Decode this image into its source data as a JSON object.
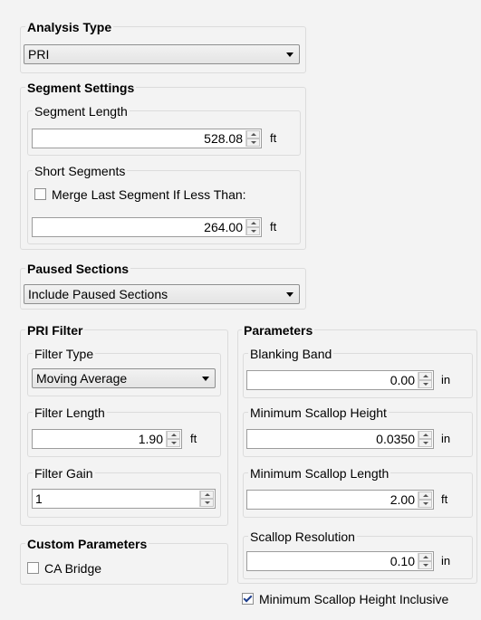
{
  "analysis_type": {
    "title": "Analysis Type",
    "selected": "PRI"
  },
  "segment_settings": {
    "title": "Segment Settings",
    "segment_length": {
      "label": "Segment Length",
      "value": "528.08",
      "unit": "ft"
    },
    "short_segments": {
      "label": "Short Segments",
      "merge_label": "Merge Last Segment If Less Than:",
      "merge_checked": false,
      "value": "264.00",
      "unit": "ft"
    }
  },
  "paused_sections": {
    "title": "Paused Sections",
    "selected": "Include Paused Sections"
  },
  "pri_filter": {
    "title": "PRI Filter",
    "filter_type": {
      "label": "Filter Type",
      "selected": "Moving Average"
    },
    "filter_length": {
      "label": "Filter Length",
      "value": "1.90",
      "unit": "ft"
    },
    "filter_gain": {
      "label": "Filter Gain",
      "value": "1"
    }
  },
  "custom_parameters": {
    "title": "Custom Parameters",
    "ca_bridge_label": "CA Bridge",
    "ca_bridge_checked": false
  },
  "parameters": {
    "title": "Parameters",
    "blanking_band": {
      "label": "Blanking Band",
      "value": "0.00",
      "unit": "in"
    },
    "min_scallop_height": {
      "label": "Minimum Scallop Height",
      "value": "0.0350",
      "unit": "in"
    },
    "min_scallop_length": {
      "label": "Minimum Scallop Length",
      "value": "2.00",
      "unit": "ft"
    },
    "scallop_resolution": {
      "label": "Scallop Resolution",
      "value": "0.10",
      "unit": "in"
    },
    "min_height_inclusive_label": "Minimum Scallop Height Inclusive",
    "min_height_inclusive_checked": true
  }
}
